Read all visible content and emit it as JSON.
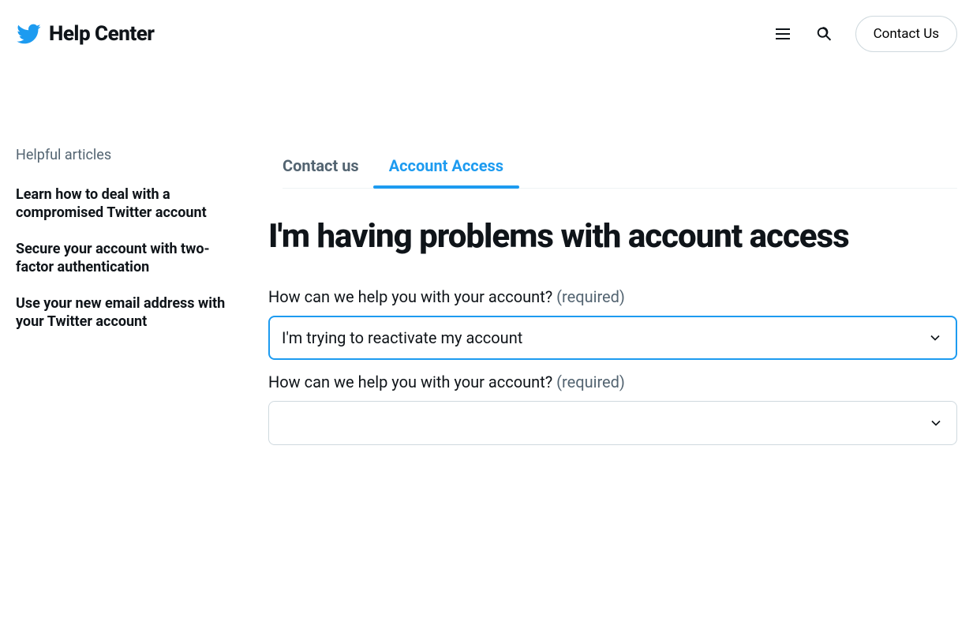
{
  "header": {
    "title": "Help Center",
    "contact_button": "Contact Us"
  },
  "sidebar": {
    "heading": "Helpful articles",
    "articles": [
      "Learn how to deal with a compromised Twitter account",
      "Secure your account with two-factor authentication",
      "Use your new email address with your Twitter account"
    ]
  },
  "breadcrumb": {
    "items": [
      {
        "label": "Contact us",
        "active": false
      },
      {
        "label": "Account Access",
        "active": true
      }
    ]
  },
  "main": {
    "title": "I'm having problems with account access",
    "fields": [
      {
        "label": "How can we help you with your account?",
        "required_text": "(required)",
        "value": "I'm trying to reactivate my account",
        "focused": true
      },
      {
        "label": "How can we help you with your account?",
        "required_text": "(required)",
        "value": "",
        "focused": false
      }
    ]
  }
}
